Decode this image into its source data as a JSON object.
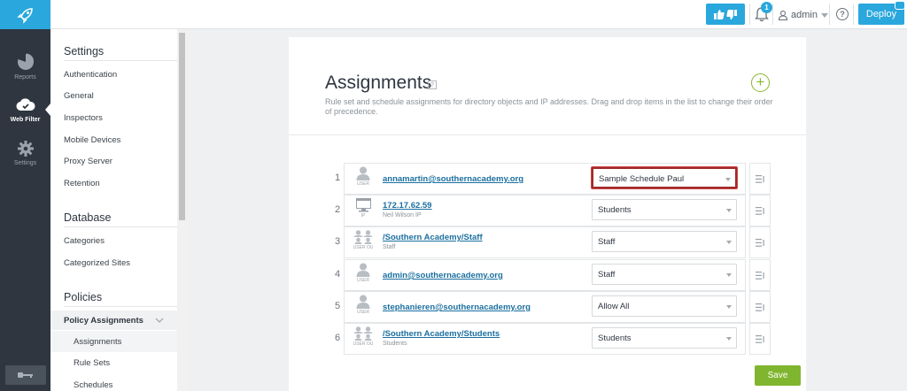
{
  "rail": {
    "items": [
      {
        "label": "Reports",
        "icon": "pie-chart-icon"
      },
      {
        "label": "Web Filter",
        "icon": "cloud-filter-icon"
      },
      {
        "label": "Settings",
        "icon": "gear-icon"
      }
    ]
  },
  "topbar": {
    "notification_count": "1",
    "user_label": "admin",
    "help_label": "?",
    "deploy_label": "Deploy"
  },
  "sidebar": {
    "settings_heading": "Settings",
    "settings_items": [
      "Authentication",
      "General",
      "Inspectors",
      "Mobile Devices",
      "Proxy Server",
      "Retention"
    ],
    "database_heading": "Database",
    "database_items": [
      "Categories",
      "Categorized Sites"
    ],
    "policies_heading": "Policies",
    "policy_group": "Policy Assignments",
    "policy_subitems": [
      "Assignments",
      "Rule Sets",
      "Schedules"
    ]
  },
  "main": {
    "title": "Assignments",
    "help_label": "?",
    "description": "Rule set and schedule assignments for directory objects and IP addresses. Drag and drop items in the list to change their order of precedence.",
    "add_label": "+",
    "rows": [
      {
        "num": "1",
        "icon": "user-icon",
        "icon_label": "USER",
        "name": "annamartin@southernacademy.org",
        "sub": "",
        "value": "Sample Schedule Paul"
      },
      {
        "num": "2",
        "icon": "ip-icon",
        "icon_label": "IP",
        "name": "172.17.62.59",
        "sub": "Neil Wilson IP",
        "value": "Students"
      },
      {
        "num": "3",
        "icon": "user-ou-icon",
        "icon_label": "USER OU",
        "name": "/Southern Academy/Staff",
        "sub": "Staff",
        "value": "Staff"
      },
      {
        "num": "4",
        "icon": "user-icon",
        "icon_label": "USER",
        "name": "admin@southernacademy.org",
        "sub": "",
        "value": "Staff"
      },
      {
        "num": "5",
        "icon": "user-icon",
        "icon_label": "USER",
        "name": "stephanieren@southernacademy.org",
        "sub": "",
        "value": "Allow All"
      },
      {
        "num": "6",
        "icon": "user-ou-icon",
        "icon_label": "USER OU",
        "name": "/Southern Academy/Students",
        "sub": "Students",
        "value": "Students"
      }
    ],
    "save_label": "Save"
  },
  "colors": {
    "brand": "#2aa7dd",
    "rail": "#2f3640",
    "save": "#80b62f",
    "highlight": "#a12a2a",
    "link": "#1a6fa0"
  }
}
